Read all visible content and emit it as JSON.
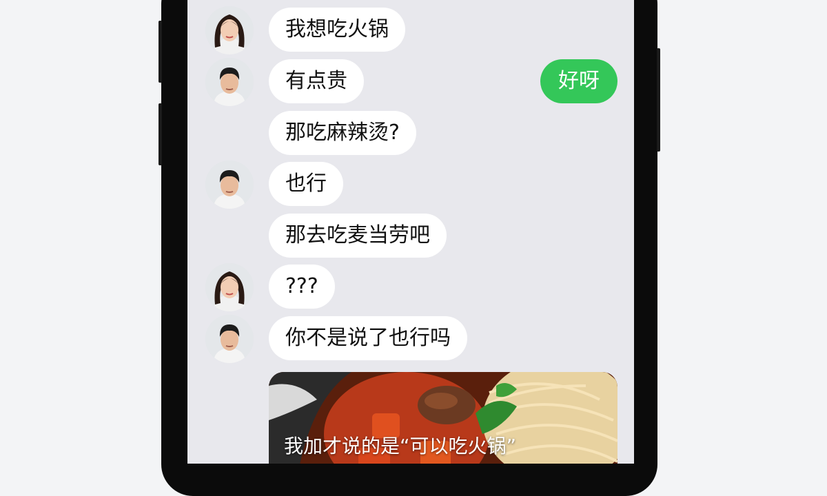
{
  "messages": [
    {
      "sender": "female",
      "text": "我想吃火锅"
    },
    {
      "sender": "male",
      "text": "有点贵"
    },
    {
      "sender": "male",
      "text": "那吃麻辣烫?"
    },
    {
      "sender": "male",
      "text": "也行"
    },
    {
      "sender": "male",
      "text": "那去吃麦当劳吧"
    },
    {
      "sender": "female",
      "text": "???"
    },
    {
      "sender": "male",
      "text": "你不是说了也行吗"
    }
  ],
  "outgoing": {
    "text": "好呀"
  },
  "photo": {
    "caption": "我加才说的是“可以吃火锅”"
  },
  "colors": {
    "outgoing_bubble": "#34c759",
    "incoming_bubble": "#ffffff",
    "screen_bg": "#e8e8ed"
  }
}
